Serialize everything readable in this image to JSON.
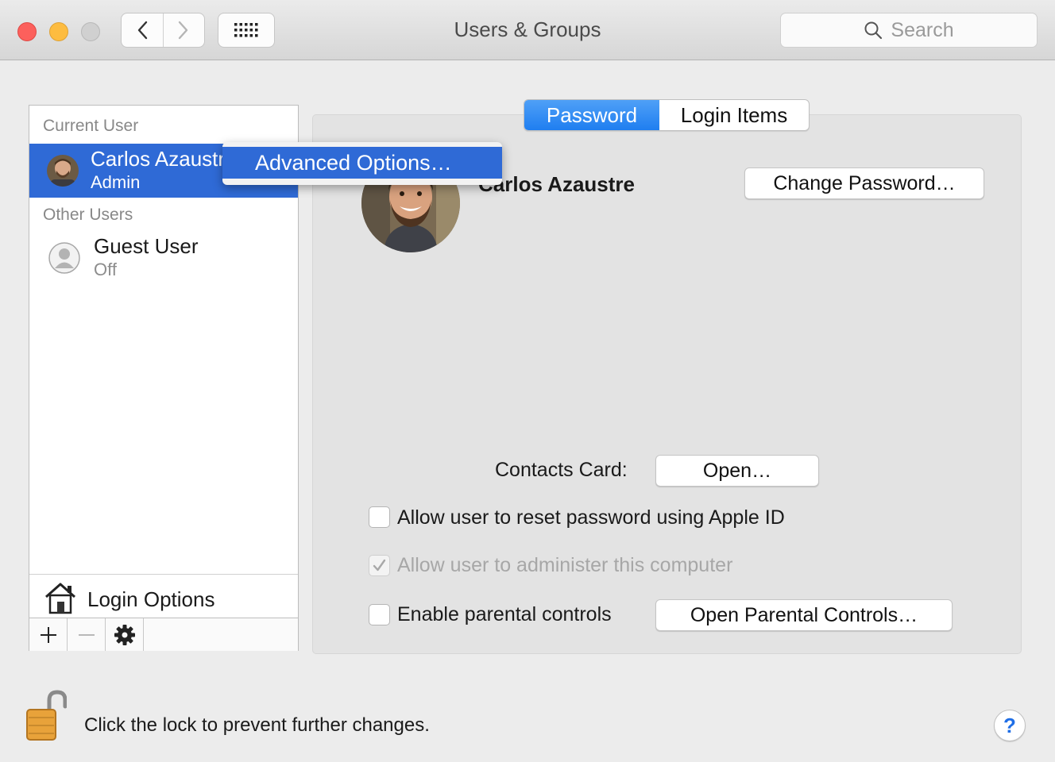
{
  "window": {
    "title": "Users & Groups"
  },
  "toolbar": {
    "search_placeholder": "Search"
  },
  "sidebar": {
    "current_header": "Current User",
    "current_user": {
      "name": "Carlos Azaustre",
      "role": "Admin"
    },
    "other_header": "Other Users",
    "other_users": [
      {
        "name": "Guest User",
        "status": "Off"
      }
    ],
    "login_options": "Login Options",
    "add_label": "+",
    "remove_label": "—"
  },
  "context_menu": {
    "item": "Advanced Options…"
  },
  "tabs": [
    {
      "label": "Password",
      "active": true
    },
    {
      "label": "Login Items",
      "active": false
    }
  ],
  "user_detail": {
    "full_name": "Carlos Azaustre",
    "change_password": "Change Password…",
    "contacts_card_label": "Contacts Card:",
    "open_button": "Open…",
    "allow_reset_label": "Allow user to reset password using Apple ID",
    "allow_reset_checked": false,
    "allow_admin_label": "Allow user to administer this computer",
    "allow_admin_checked": true,
    "parental_label": "Enable parental controls",
    "parental_checked": false,
    "open_parental_button": "Open Parental Controls…"
  },
  "footer": {
    "lock_text": "Click the lock to prevent further changes.",
    "help": "?"
  },
  "colors": {
    "selection": "#2f6ad6",
    "tab_active": "#1f7ef0"
  }
}
